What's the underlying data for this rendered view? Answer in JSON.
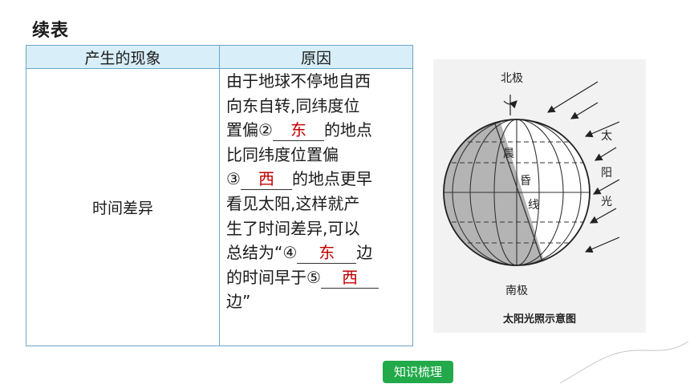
{
  "title": "续表",
  "table": {
    "headers": [
      "产生的现象",
      "原因"
    ],
    "phenomenon": "时间差异",
    "reason": {
      "l1": "由于地球不停地自西",
      "l2": "向东自转,同纬度位",
      "l3_pre": "置偏②",
      "a2": "东",
      "l3_post": "的地点",
      "l4": "比同纬度位置偏",
      "l5_pre": "③",
      "a3": "西",
      "l5_post": "的地点更早",
      "l6": "看见太阳,这样就产",
      "l7": "生了时间差异,可以",
      "l8_pre": "总结为“④",
      "a4": "东",
      "l8_post": "边",
      "l9_pre": "的时间早于⑤",
      "a5": "西",
      "l10": "边”"
    }
  },
  "figure": {
    "north_label": "北极",
    "south_label": "南极",
    "sun_chars": [
      "太",
      "阳",
      "光"
    ],
    "terminator_chars": [
      "晨",
      "昏",
      "线"
    ],
    "caption": "太阳光照示意图"
  },
  "nav_button": "知识梳理",
  "colors": {
    "answer": "#c00000",
    "header_bg": "#d8eef9",
    "border": "#6aa6c8",
    "button": "#22a94a"
  }
}
